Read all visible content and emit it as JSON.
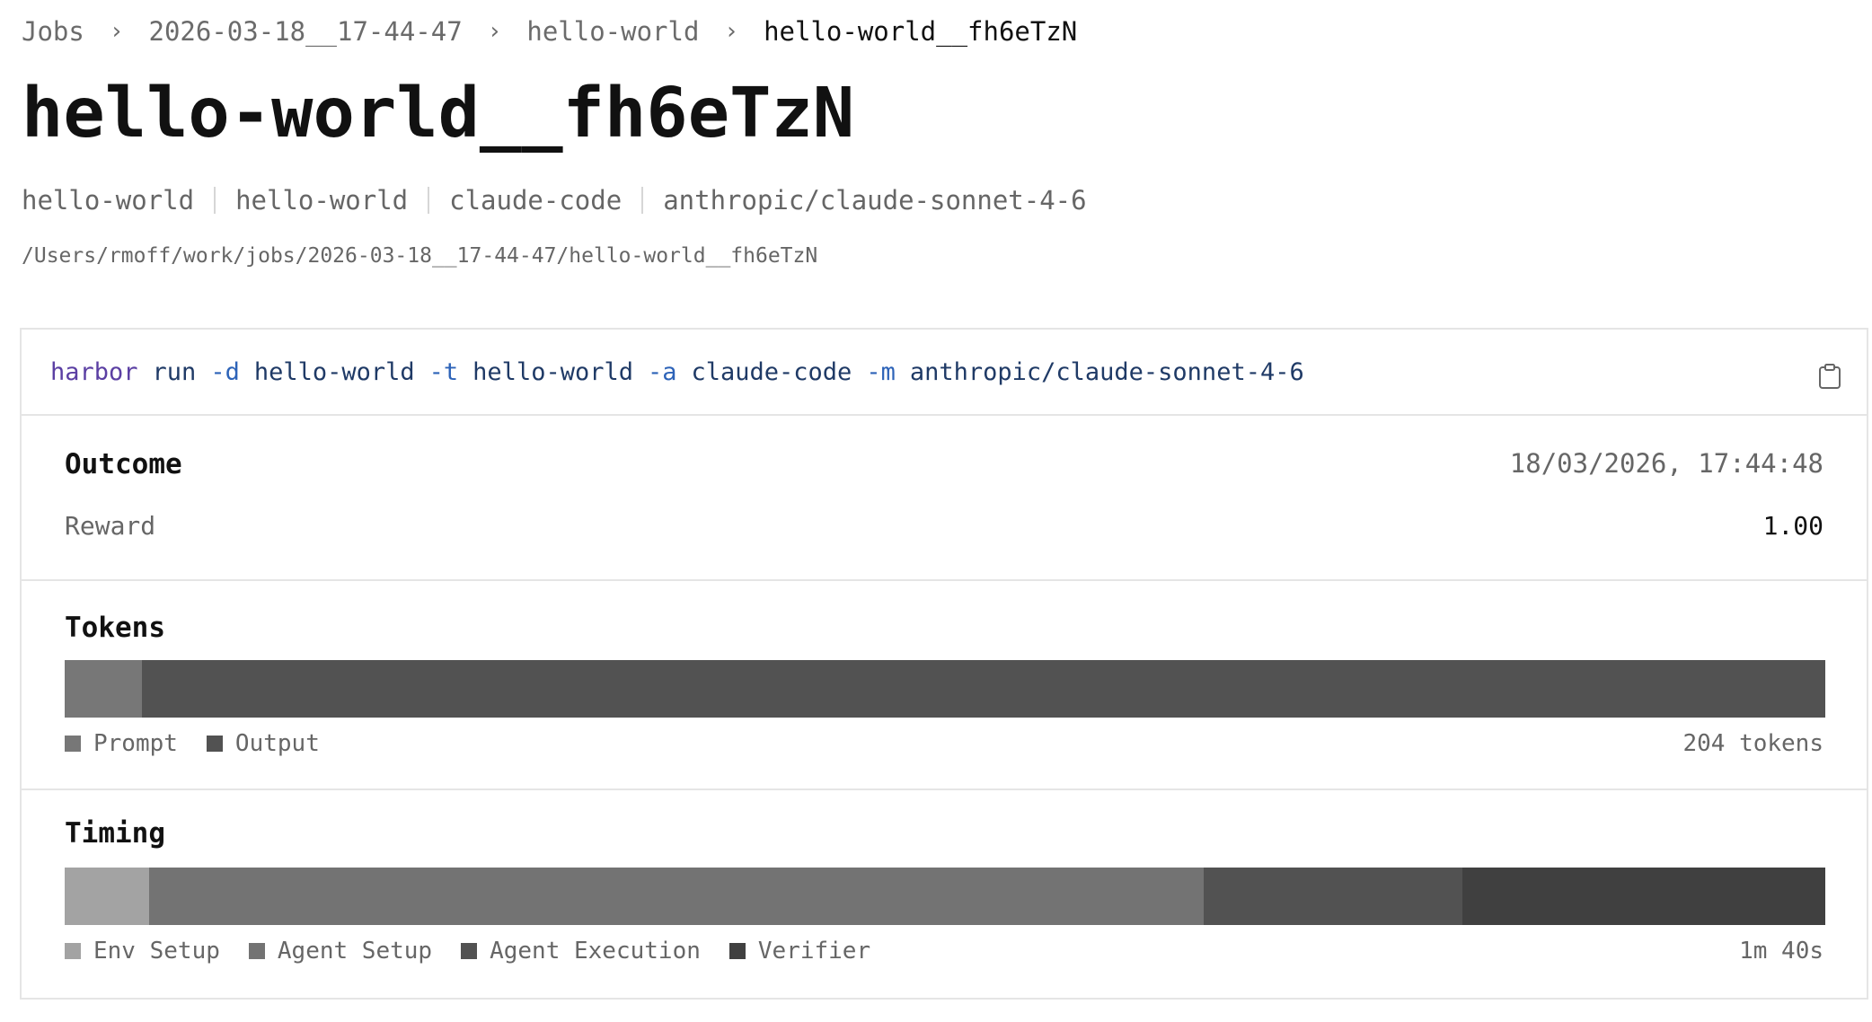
{
  "breadcrumb": {
    "items": [
      "Jobs",
      "2026-03-18__17-44-47",
      "hello-world",
      "hello-world__fh6eTzN"
    ],
    "separator": "›"
  },
  "title": "hello-world__fh6eTzN",
  "meta": {
    "dataset": "hello-world",
    "task": "hello-world",
    "agent": "claude-code",
    "model": "anthropic/claude-sonnet-4-6"
  },
  "path": "/Users/rmoff/work/jobs/2026-03-18__17-44-47/hello-world__fh6eTzN",
  "command": {
    "program": "harbor",
    "subcommand": "run",
    "args": [
      {
        "flag": "-d",
        "value": "hello-world"
      },
      {
        "flag": "-t",
        "value": "hello-world"
      },
      {
        "flag": "-a",
        "value": "claude-code"
      },
      {
        "flag": "-m",
        "value": "anthropic/claude-sonnet-4-6"
      }
    ],
    "copy_icon": "clipboard-icon"
  },
  "outcome": {
    "title": "Outcome",
    "timestamp": "18/03/2026, 17:44:48",
    "reward_label": "Reward",
    "reward_value": "1.00"
  },
  "tokens": {
    "title": "Tokens",
    "total_label": "204 tokens",
    "segments": [
      {
        "name": "Prompt",
        "fraction": 0.044,
        "color": "#777777"
      },
      {
        "name": "Output",
        "fraction": 0.956,
        "color": "#525252"
      }
    ]
  },
  "timing": {
    "title": "Timing",
    "total_label": "1m 40s",
    "segments": [
      {
        "name": "Env Setup",
        "fraction": 0.048,
        "color": "#a3a3a3"
      },
      {
        "name": "Agent Setup",
        "fraction": 0.599,
        "color": "#737373"
      },
      {
        "name": "Agent Execution",
        "fraction": 0.147,
        "color": "#525252"
      },
      {
        "name": "Verifier",
        "fraction": 0.206,
        "color": "#404040"
      }
    ]
  }
}
